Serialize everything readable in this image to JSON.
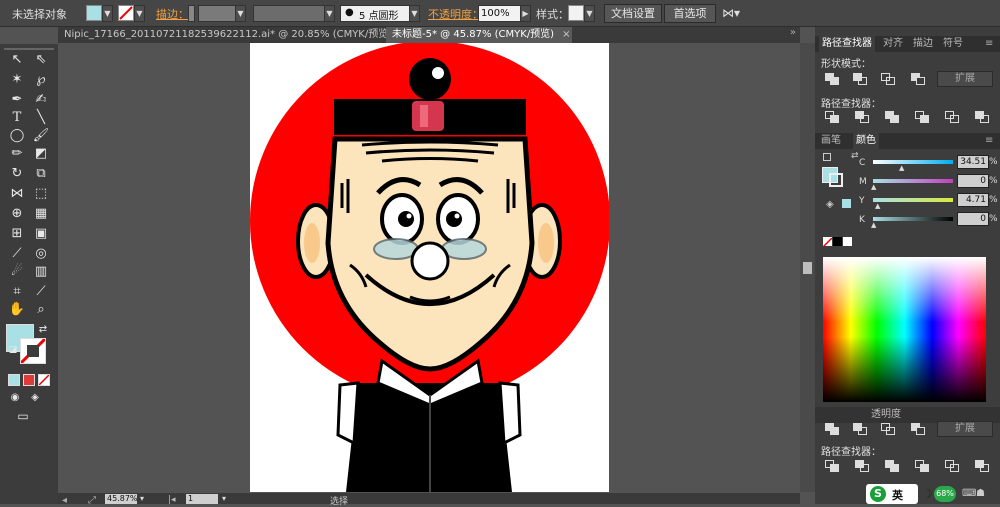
{
  "control_bar": {
    "selection_label": "未选择对象",
    "stroke_label": "描边：",
    "brush_label": "5 点圆形",
    "opacity_label": "不透明度：",
    "opacity_value": "100%",
    "style_label": "样式：",
    "doc_setup_button": "文档设置",
    "preferences_button": "首选项"
  },
  "tabs": [
    {
      "label": "Nipic_17166_20110721182539622112.ai* @ 20.85% (CMYK/预览)",
      "close": "×"
    },
    {
      "label": "未标题-5* @ 45.87% (CMYK/预览)",
      "close": "×"
    }
  ],
  "panel": {
    "tabs": [
      "路径查找器",
      "对齐",
      "描边",
      "符号"
    ],
    "shape_modes_label": "形状模式：",
    "pathfinder_label": "路径查找器：",
    "expand_button": "扩展",
    "color_tabs": [
      "画笔",
      "颜色"
    ],
    "sliders": [
      {
        "label": "C",
        "value": "34.51",
        "unit": "%"
      },
      {
        "label": "M",
        "value": "0",
        "unit": "%"
      },
      {
        "label": "Y",
        "value": "4.71",
        "unit": "%"
      },
      {
        "label": "K",
        "value": "0",
        "unit": "%"
      }
    ],
    "bottom_tabs": [
      "透明度"
    ],
    "bottom_pathfinder_label": "路径查找器：",
    "bottom_expand_button": "扩展"
  },
  "status": {
    "zoom": "45.87%",
    "page": "1",
    "tool_name": "选择"
  },
  "taskbar": {
    "ime_label": "英",
    "battery": "68%"
  },
  "colors": {
    "fill": "#a9e0e6",
    "circle": "#ff0000",
    "skin": "#fce4bd"
  }
}
